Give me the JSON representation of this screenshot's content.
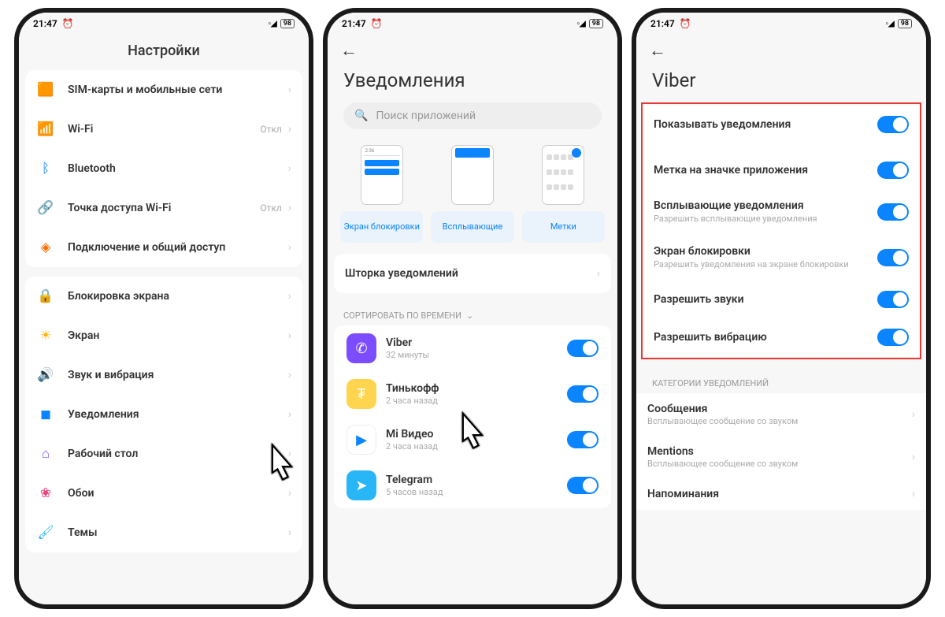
{
  "status": {
    "time": "21:47",
    "battery": "98",
    "net": "4G"
  },
  "screen1": {
    "title": "Настройки",
    "groups": [
      [
        {
          "icon": "🟧",
          "color": "#ffb300",
          "label": "SIM-карты и мобильные сети"
        },
        {
          "icon": "📶",
          "color": "#0a84ff",
          "label": "Wi-Fi",
          "value": "Откл"
        },
        {
          "icon": "ᛒ",
          "color": "#0a84ff",
          "label": "Bluetooth"
        },
        {
          "icon": "🔗",
          "color": "#ffb300",
          "label": "Точка доступа Wi-Fi",
          "value": "Откл"
        },
        {
          "icon": "◈",
          "color": "#ff6d00",
          "label": "Подключение и общий доступ"
        }
      ],
      [
        {
          "icon": "🔒",
          "color": "#e53935",
          "label": "Блокировка экрана"
        },
        {
          "icon": "☀",
          "color": "#ffb300",
          "label": "Экран"
        },
        {
          "icon": "🔊",
          "color": "#43a047",
          "label": "Звук и вибрация"
        },
        {
          "icon": "◼",
          "color": "#0a84ff",
          "label": "Уведомления"
        },
        {
          "icon": "⌂",
          "color": "#7c4dff",
          "label": "Рабочий стол"
        },
        {
          "icon": "❀",
          "color": "#ec407a",
          "label": "Обои"
        },
        {
          "icon": "🖌",
          "color": "#29b6f6",
          "label": "Темы"
        }
      ]
    ]
  },
  "screen2": {
    "title": "Уведомления",
    "search_placeholder": "Поиск приложений",
    "previews": [
      "Экран блокировки",
      "Всплывающие",
      "Метки"
    ],
    "shade_row": "Шторка уведомлений",
    "sort_label": "СОРТИРОВАТЬ ПО ВРЕМЕНИ",
    "apps": [
      {
        "name": "Viber",
        "sub": "32 минуты",
        "bg": "#7c4dff",
        "glyph": "✆"
      },
      {
        "name": "Тинькофф",
        "sub": "2 часа назад",
        "bg": "#ffd54f",
        "glyph": "₮"
      },
      {
        "name": "Mi Видео",
        "sub": "2 часа назад",
        "bg": "#fff",
        "glyph": "▶"
      },
      {
        "name": "Telegram",
        "sub": "5 часов назад",
        "bg": "#29b6f6",
        "glyph": "➤"
      }
    ]
  },
  "screen3": {
    "title": "Viber",
    "toggles": [
      {
        "title": "Показывать уведомления"
      },
      {
        "title": "Метка на значке приложения"
      },
      {
        "title": "Всплывающие уведомления",
        "sub": "Разрешить всплывающие уведомления"
      },
      {
        "title": "Экран блокировки",
        "sub": "Разрешить уведомления на экране блокировки"
      },
      {
        "title": "Разрешить звуки"
      },
      {
        "title": "Разрешить вибрацию"
      }
    ],
    "cat_label": "КАТЕГОРИИ УВЕДОМЛЕНИЙ",
    "categories": [
      {
        "title": "Сообщения",
        "sub": "Всплывающее сообщение со звуком"
      },
      {
        "title": "Mentions",
        "sub": "Всплывающее сообщение со звуком"
      },
      {
        "title": "Напоминания",
        "sub": ""
      }
    ]
  }
}
